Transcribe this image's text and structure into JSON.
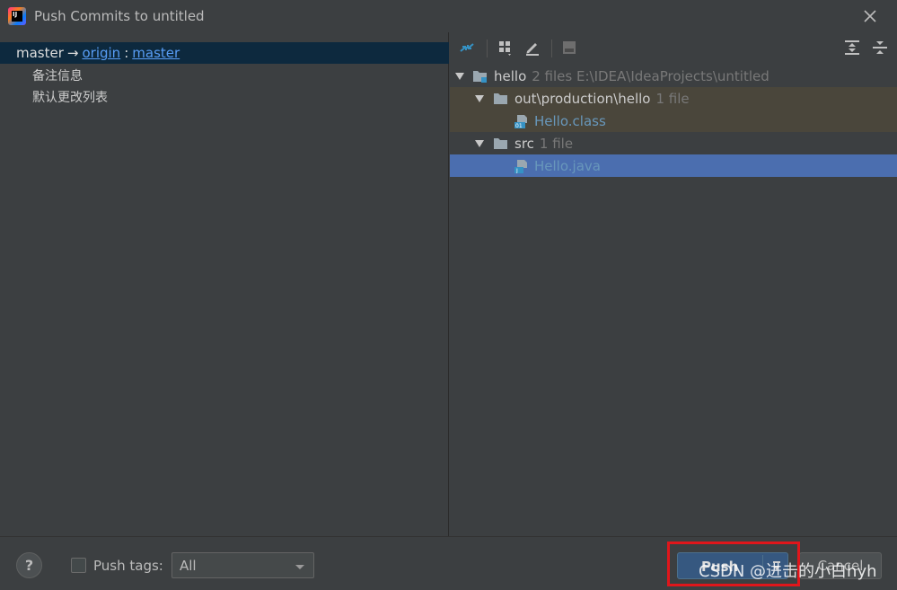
{
  "window": {
    "title": "Push Commits to untitled",
    "app_icon": "intellij-idea-icon",
    "app_icon_text": "IJ",
    "close_icon": "close-icon"
  },
  "left_pane": {
    "branch": {
      "local": "master",
      "arrow": "→",
      "remote": "origin",
      "separator": ":",
      "remote_branch": "master"
    },
    "commits": [
      "备注信息",
      "默认更改列表"
    ]
  },
  "toolbar": {
    "icons": [
      "pin-arrows-icon",
      "group-by-icon",
      "edit-icon",
      "diff-icon",
      "expand-all-icon",
      "collapse-all-icon"
    ]
  },
  "tree": {
    "rows": [
      {
        "label": "hello",
        "meta": "2 files  E:\\IDEA\\IdeaProjects\\untitled",
        "type": "module"
      },
      {
        "label": "out\\production\\hello",
        "meta": "1 file",
        "type": "folder"
      },
      {
        "label": "Hello.class",
        "meta": "",
        "type": "class-file"
      },
      {
        "label": "src",
        "meta": "1 file",
        "type": "folder"
      },
      {
        "label": "Hello.java",
        "meta": "",
        "type": "java-file"
      }
    ],
    "colors": {
      "highlight": "#4a463b",
      "selected": "#4b6eaf",
      "file_blue": "#6897bb"
    }
  },
  "bottom_bar": {
    "help_label": "?",
    "push_tags_label": "Push tags:",
    "push_tags_checked": false,
    "tags_select_value": "All",
    "push_label": "Push",
    "cancel_label": "Cancel",
    "highlight_color": "#e0161b"
  },
  "watermark": "CSDN @进击的小白hyh"
}
